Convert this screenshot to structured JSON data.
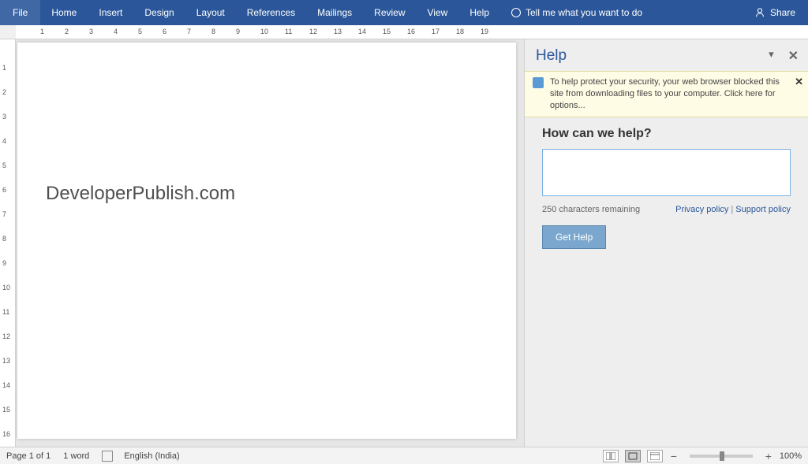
{
  "ribbon": {
    "tabs": [
      "File",
      "Home",
      "Insert",
      "Design",
      "Layout",
      "References",
      "Mailings",
      "Review",
      "View",
      "Help"
    ],
    "tell_me": "Tell me what you want to do",
    "share": "Share"
  },
  "document": {
    "content": "DeveloperPublish.com"
  },
  "help": {
    "title": "Help",
    "security_msg_1": "To help protect your security, your web browser blocked this site from downloading files to your computer. Click ",
    "security_link": "here",
    "security_msg_2": " for options...",
    "question": "How can we help?",
    "chars_remaining": "250 characters remaining",
    "privacy": "Privacy policy",
    "support": "Support policy",
    "button": "Get Help"
  },
  "status": {
    "page": "Page 1 of 1",
    "words": "1 word",
    "lang": "English (India)",
    "zoom": "100%"
  }
}
